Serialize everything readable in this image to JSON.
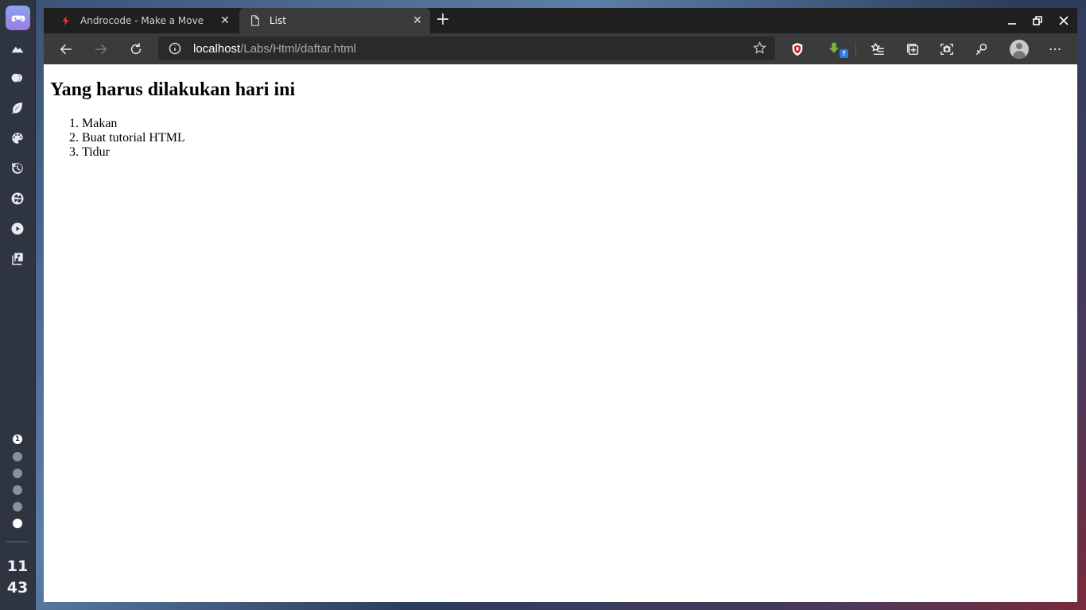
{
  "dock": {
    "workspace_active_number": "1",
    "clock_hour": "11",
    "clock_minute": "43"
  },
  "tabs": [
    {
      "label": "Androcode - Make a Move",
      "icon": "androcode-bolt-icon",
      "close": "✕"
    },
    {
      "label": "List",
      "icon": "page-icon",
      "close": "✕"
    }
  ],
  "new_tab": "+",
  "address_bar": {
    "host": "localhost",
    "path": "/Labs/Html/daftar.html"
  },
  "extensions": {
    "download_badge": "?"
  },
  "page": {
    "heading": "Yang harus dilakukan hari ini",
    "items": [
      "Makan",
      "Buat tutorial HTML",
      "Tidur"
    ]
  },
  "colors": {
    "tabbar_bg": "#1f1f1f",
    "toolbar_bg": "#3b3b3b",
    "dock_bg": "#2e3440",
    "accent_red": "#e53935"
  }
}
